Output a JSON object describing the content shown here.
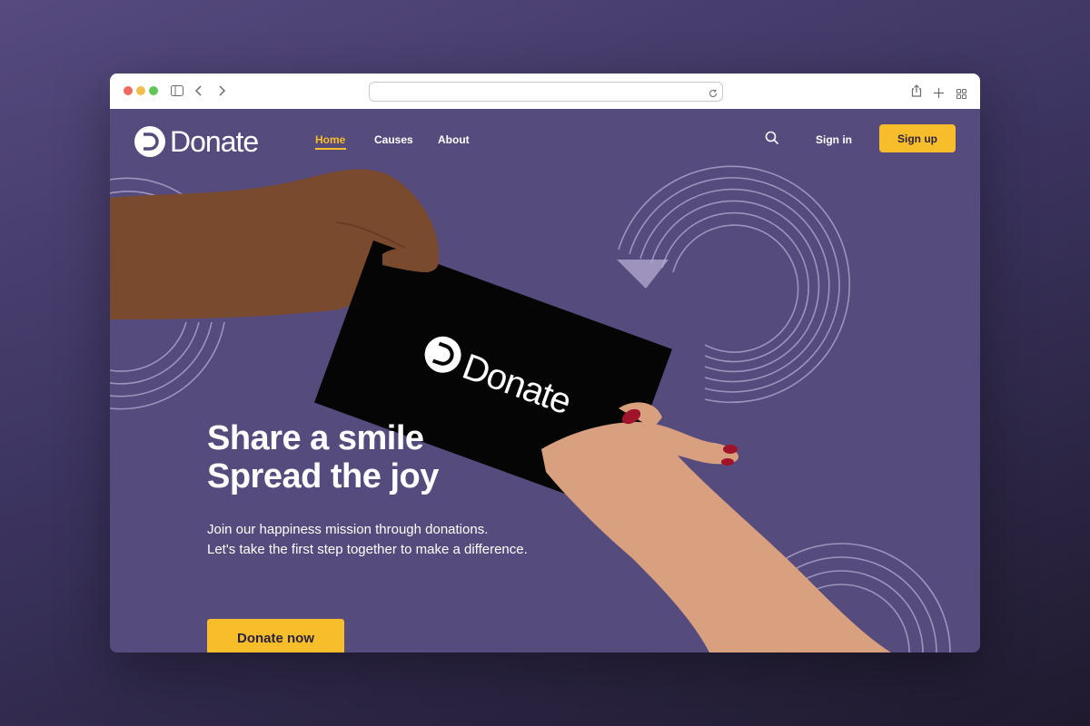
{
  "browser": {
    "url": ""
  },
  "brand": {
    "name": "Donate",
    "accent": "#f8bd2b",
    "background": "#564b7d"
  },
  "nav": {
    "items": [
      {
        "label": "Home",
        "active": true
      },
      {
        "label": "Causes",
        "active": false
      },
      {
        "label": "About",
        "active": false
      }
    ],
    "search_icon": "search-icon",
    "sign_in": "Sign in",
    "sign_up": "Sign up"
  },
  "hero": {
    "headline_line1": "Share a smile",
    "headline_line2": "Spread the joy",
    "sub_line1": "Join our happiness mission through donations.",
    "sub_line2": "Let's take the first step together to make a difference.",
    "cta": "Donate now",
    "card_text": "Donate"
  }
}
